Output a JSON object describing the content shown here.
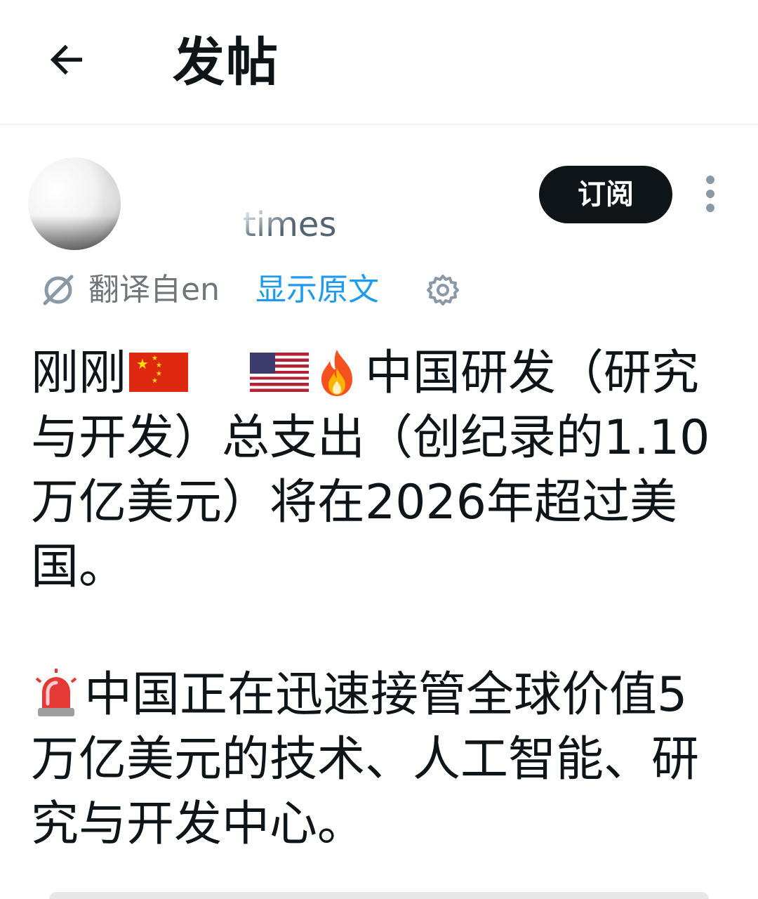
{
  "header": {
    "back_label": "←",
    "title": "发帖"
  },
  "author": {
    "name_visible": "times",
    "subscribe_label": "订阅"
  },
  "translation": {
    "translated_from": "翻译自en",
    "show_original": "显示原文"
  },
  "post": {
    "line1_prefix": "刚刚",
    "line1_suffix": "中国研发（研究与开发）总支出（创纪录的1.10万亿美元）将在2026年超过美国。",
    "paragraph2": "中国正在迅速接管全球价值5万亿美元的技术、人工智能、研究与开发中心。"
  },
  "icons": {
    "back": "arrow-left-icon",
    "more": "more-vertical-icon",
    "translate": "translate-icon",
    "settings": "gear-icon",
    "flag_cn": "china-flag-icon",
    "flag_us": "us-flag-icon",
    "fire": "fire-emoji-icon",
    "siren": "police-light-emoji-icon"
  },
  "colors": {
    "text": "#0f1419",
    "secondary": "#71767b",
    "link": "#1d9bf0",
    "button_bg": "#0f1419"
  }
}
